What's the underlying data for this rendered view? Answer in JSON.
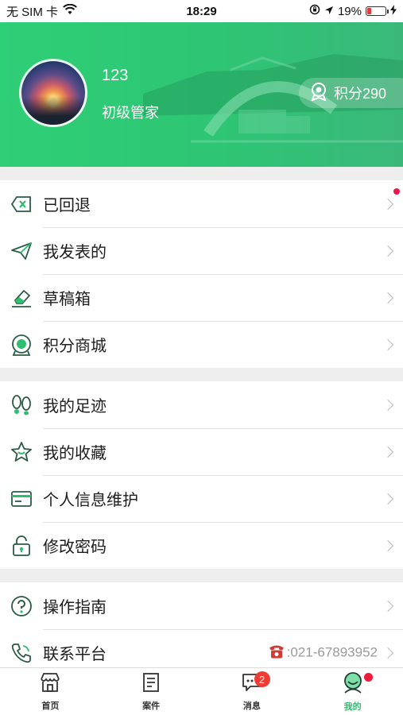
{
  "status_bar": {
    "carrier": "无 SIM 卡",
    "time": "18:29",
    "battery_percent": "19%",
    "battery_level": 0.19
  },
  "profile": {
    "name": "123",
    "level": "初级管家",
    "points_label": "积分290"
  },
  "menu": {
    "group1": [
      {
        "label": "已回退",
        "icon": "return-icon",
        "unread_dot": true
      },
      {
        "label": "我发表的",
        "icon": "paper-plane-icon"
      },
      {
        "label": "草稿箱",
        "icon": "eraser-icon"
      },
      {
        "label": "积分商城",
        "icon": "points-medal-icon"
      }
    ],
    "group2": [
      {
        "label": "我的足迹",
        "icon": "footprints-icon"
      },
      {
        "label": "我的收藏",
        "icon": "star-icon"
      },
      {
        "label": "个人信息维护",
        "icon": "id-card-icon"
      },
      {
        "label": "修改密码",
        "icon": "lock-icon"
      }
    ],
    "group3": [
      {
        "label": "操作指南",
        "icon": "help-icon"
      },
      {
        "label": "联系平台",
        "icon": "phone-icon",
        "phone": ":021-67893952"
      }
    ]
  },
  "tabbar": {
    "tabs": [
      {
        "label": "首页",
        "icon": "store-icon"
      },
      {
        "label": "案件",
        "icon": "document-icon"
      },
      {
        "label": "消息",
        "icon": "chat-icon",
        "badge": "2"
      },
      {
        "label": "我的",
        "icon": "profile-icon",
        "active": true
      }
    ]
  },
  "colors": {
    "accent": "#2dbf6e",
    "badge": "#ee3b33"
  }
}
